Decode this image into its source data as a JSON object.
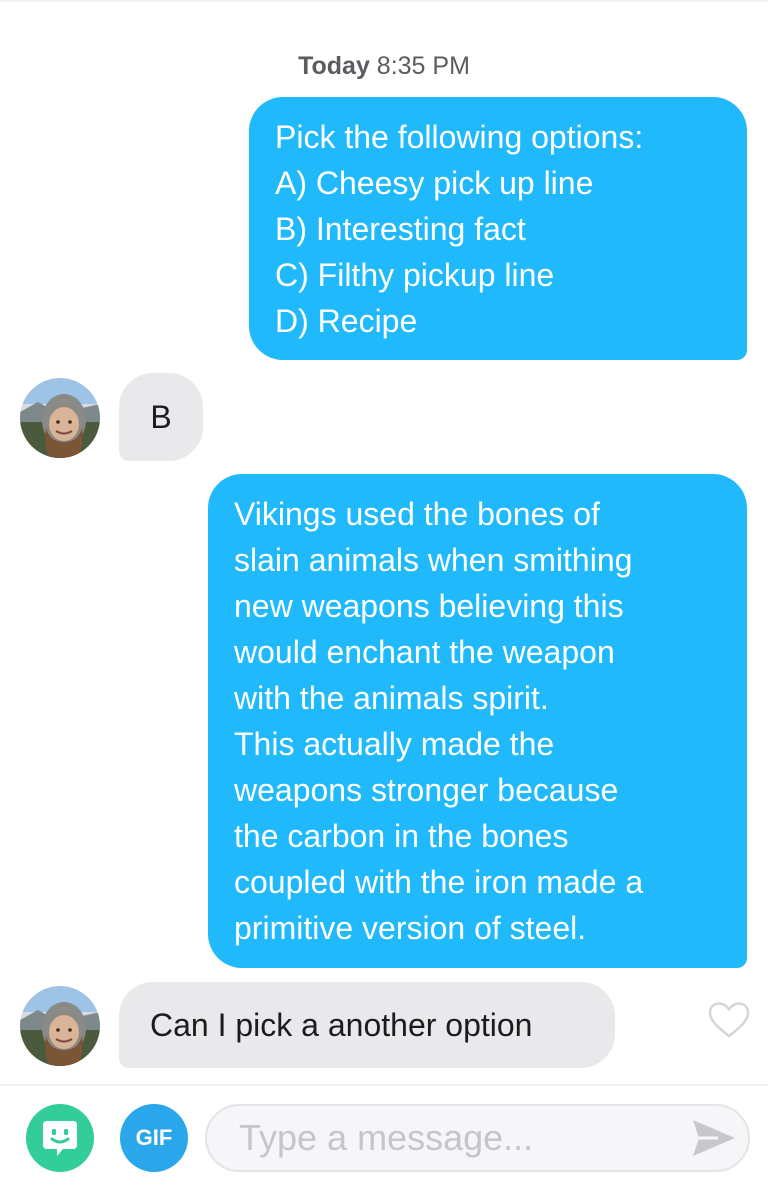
{
  "conversation": {
    "timestamp_day": "Today",
    "timestamp_time": "8:35 PM",
    "messages": [
      {
        "direction": "sent",
        "lines": [
          "Pick the following options:",
          "A) Cheesy pick up line",
          "B) Interesting fact",
          "C) Filthy pickup line",
          "D) Recipe"
        ]
      },
      {
        "direction": "received",
        "text": "B"
      },
      {
        "direction": "sent",
        "lines": [
          "Vikings used the bones of",
          "slain animals when smithing",
          "new weapons believing this",
          "would enchant the weapon",
          "with the animals spirit.",
          "This actually made the",
          "weapons stronger because",
          "the carbon in the bones",
          "coupled with the iron made a",
          "primitive version of steel."
        ]
      },
      {
        "direction": "received",
        "text": "Can I pick a another option"
      }
    ]
  },
  "composer": {
    "gif_label": "GIF",
    "input_placeholder": "Type a message...",
    "input_value": "",
    "sticker_icon": "sticker-face-icon",
    "send_icon": "send-arrow-icon"
  },
  "colors": {
    "sent_bubble": "#20b9fb",
    "received_bubble": "#e9e9ec",
    "sticker_button": "#33cd9a",
    "gif_button": "#2aa7ea"
  }
}
